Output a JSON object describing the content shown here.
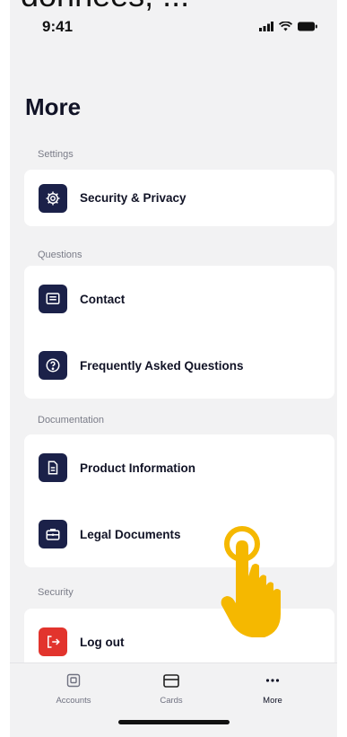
{
  "caption": "données, ...",
  "status": {
    "time": "9:41"
  },
  "page": {
    "title": "More"
  },
  "sections": {
    "settings": {
      "label": "Settings",
      "items": [
        {
          "label": "Security & Privacy",
          "icon": "gear-icon"
        }
      ]
    },
    "questions": {
      "label": "Questions",
      "items": [
        {
          "label": "Contact",
          "icon": "message-icon"
        },
        {
          "label": "Frequently Asked Questions",
          "icon": "question-icon"
        }
      ]
    },
    "documentation": {
      "label": "Documentation",
      "items": [
        {
          "label": "Product Information",
          "icon": "document-icon"
        },
        {
          "label": "Legal Documents",
          "icon": "briefcase-icon"
        }
      ]
    },
    "security": {
      "label": "Security",
      "items": [
        {
          "label": "Log out",
          "icon": "logout-icon"
        }
      ]
    }
  },
  "tabbar": {
    "tabs": [
      {
        "label": "Accounts",
        "icon": "accounts-icon"
      },
      {
        "label": "Cards",
        "icon": "card-icon"
      },
      {
        "label": "More",
        "icon": "more-dots-icon",
        "active": true
      }
    ]
  },
  "colors": {
    "icon_bg": "#1b2149",
    "danger": "#e2342d",
    "background": "#f2f2f3",
    "pointer": "#f5b800"
  }
}
